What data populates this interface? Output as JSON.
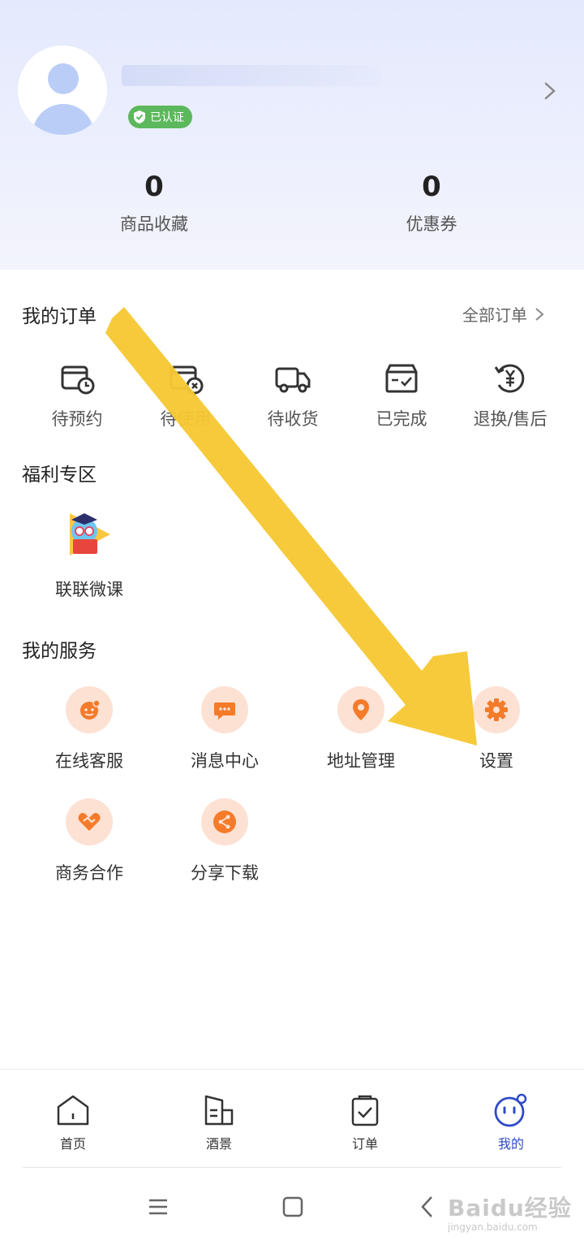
{
  "profile": {
    "verified_badge": "已认证"
  },
  "stats": [
    {
      "value": "0",
      "label": "商品收藏"
    },
    {
      "value": "0",
      "label": "优惠券"
    }
  ],
  "orders": {
    "title": "我的订单",
    "all_link": "全部订单",
    "items": [
      {
        "label": "待预约",
        "icon": "calendar-clock-icon"
      },
      {
        "label": "待使用",
        "icon": "card-x-icon"
      },
      {
        "label": "待收货",
        "icon": "truck-icon"
      },
      {
        "label": "已完成",
        "icon": "box-check-icon"
      },
      {
        "label": "退换/售后",
        "icon": "refund-yen-icon"
      }
    ]
  },
  "welfare": {
    "title": "福利专区",
    "items": [
      {
        "label": "联联微课",
        "icon": "course-mascot-icon"
      }
    ]
  },
  "services": {
    "title": "我的服务",
    "accent": "#f47b2a",
    "items": [
      {
        "label": "在线客服",
        "icon": "customer-service-icon"
      },
      {
        "label": "消息中心",
        "icon": "message-icon"
      },
      {
        "label": "地址管理",
        "icon": "location-icon"
      },
      {
        "label": "设置",
        "icon": "gear-icon"
      },
      {
        "label": "商务合作",
        "icon": "handshake-icon"
      },
      {
        "label": "分享下载",
        "icon": "share-icon"
      }
    ]
  },
  "tabbar": {
    "active_color": "#2f4bc7",
    "items": [
      {
        "label": "首页",
        "icon": "home-icon"
      },
      {
        "label": "酒景",
        "icon": "hotel-icon"
      },
      {
        "label": "订单",
        "icon": "order-bag-icon"
      },
      {
        "label": "我的",
        "icon": "profile-face-icon",
        "active": true
      }
    ]
  },
  "watermark": {
    "logo": "Baidu经验",
    "url": "jingyan.baidu.com"
  },
  "annotation": {
    "arrow_color": "#f6c832"
  }
}
